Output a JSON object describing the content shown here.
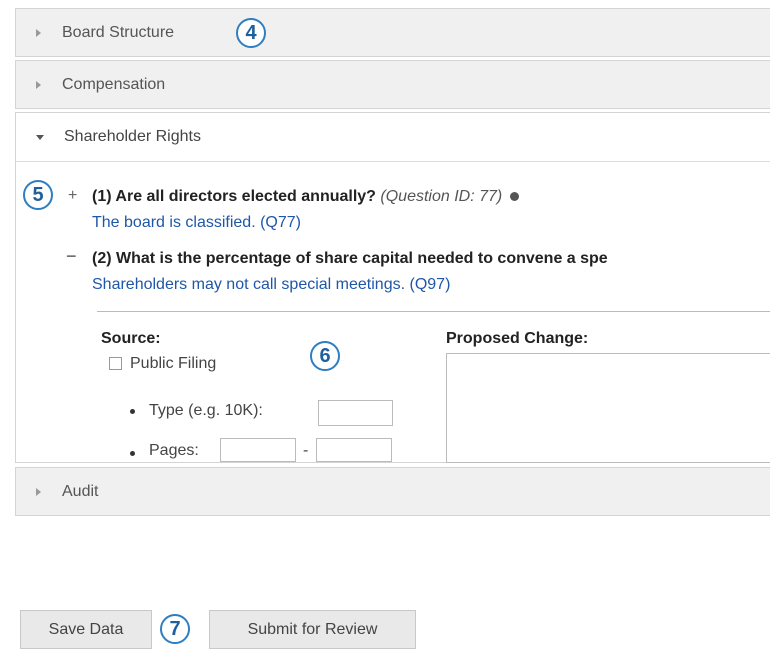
{
  "sections": {
    "board_structure": "Board Structure",
    "compensation": "Compensation",
    "shareholder_rights": "Shareholder Rights",
    "audit": "Audit"
  },
  "callouts": {
    "c4": "4",
    "c5": "5",
    "c6": "6",
    "c7": "7"
  },
  "questions": [
    {
      "toggle": "+",
      "title": "(1) Are all directors elected annually?",
      "id_text": "(Question ID: 77)",
      "answer": "The board is classified. (Q77)"
    },
    {
      "toggle": "−",
      "title": "(2) What is the percentage of share capital needed to convene a spe",
      "answer": "Shareholders may not call special meetings. (Q97)"
    }
  ],
  "form": {
    "source_label": "Source:",
    "public_filing": "Public Filing",
    "type_label": "Type (e.g. 10K):",
    "pages_label": "Pages:",
    "pages_sep": "-",
    "proposed_change_label": "Proposed Change:"
  },
  "buttons": {
    "save": "Save Data",
    "submit": "Submit for Review"
  }
}
